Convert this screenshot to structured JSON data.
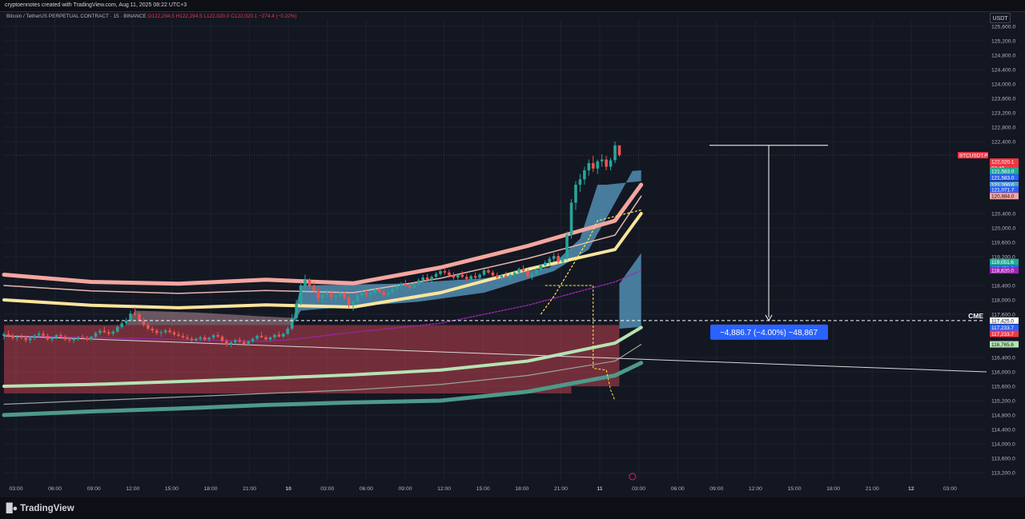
{
  "header": {
    "creator": "cryptoennotes created with TradingView.com, Aug 11, 2025 08:22 UTC+3"
  },
  "legend": {
    "symbol": "Bitcoin / TetherUS PERPETUAL CONTRACT · 15 · BINANCE",
    "open": "O122,294.5",
    "high": "H122,294.5",
    "low": "L122,020.0",
    "close": "C122,020.1",
    "change": "−274.4 (−0.22%)"
  },
  "currency": "USDT",
  "footer": {
    "brand": "TradingView"
  },
  "colors": {
    "background": "#131722",
    "up": "#26a69a",
    "down": "#ef5350",
    "ema_pink": "#f4a6a0",
    "ema_yellow": "#fbe59c",
    "ema_green": "#b6e3b2",
    "ema_teal": "#4e9a8a",
    "cloud_blue": "#5b9fc6",
    "cloud_red": "#c0424e",
    "vwap_purple": "#9c27b0"
  },
  "chart_data": {
    "type": "candlestick",
    "symbol": "BTCUSDT.P",
    "exchange": "BINANCE",
    "interval": "15",
    "ylim": [
      113000,
      125800
    ],
    "y_ticks": [
      113200,
      113600,
      114000,
      114400,
      114800,
      115200,
      115600,
      116000,
      116400,
      117600,
      118000,
      118400,
      119200,
      119600,
      120000,
      120400,
      122400,
      122800,
      123200,
      123600,
      124000,
      124400,
      124800,
      125200,
      125600
    ],
    "x_ticks": [
      "03:00",
      "06:00",
      "09:00",
      "12:00",
      "15:00",
      "18:00",
      "21:00",
      "10",
      "03:00",
      "06:00",
      "09:00",
      "12:00",
      "15:00",
      "18:00",
      "21:00",
      "11",
      "03:00",
      "06:00",
      "09:00",
      "12:00",
      "15:00",
      "18:00",
      "21:00",
      "12",
      "03:00"
    ],
    "price_labels": [
      {
        "text": "BTCUSDT.P",
        "value": 122020.1,
        "color": "#f23645"
      },
      {
        "text": "122,020.1",
        "value": 122020.1,
        "color": "#f23645"
      },
      {
        "text": "07:49",
        "value": 122020.1,
        "color": "#f23645"
      },
      {
        "text": "121,583.0",
        "value": 121583.0,
        "color": "#22ab94"
      },
      {
        "text": "121,583.0",
        "value": 121583.0,
        "color": "#2962ff"
      },
      {
        "text": "121,200.0",
        "value": 121200.0,
        "color": "#5b9fc6"
      },
      {
        "text": "121,071.7",
        "value": 121071.7,
        "color": "#2962ff"
      },
      {
        "text": "121,071.7",
        "value": 121071.7,
        "color": "#f23645"
      },
      {
        "text": "120,884.0",
        "value": 120884.0,
        "color": "#f4a6a0"
      },
      {
        "text": "119,051.6",
        "value": 119051.6,
        "color": "#22ab94"
      },
      {
        "text": "119,051.6",
        "value": 119051.6,
        "color": "#2962ff"
      },
      {
        "text": "118,820.0",
        "value": 118820.0,
        "color": "#9c27b0"
      },
      {
        "text": "117,425.0",
        "value": 117425.0,
        "color": "#ffffff"
      },
      {
        "text": "117,233.7",
        "value": 117233.7,
        "color": "#2962ff"
      },
      {
        "text": "117,233.7",
        "value": 117233.7,
        "color": "#f23645"
      },
      {
        "text": "116,765.6",
        "value": 116765.6,
        "color": "#b6e3b2"
      }
    ],
    "levels": [
      {
        "name": "CME",
        "value": 117425.0
      }
    ],
    "measure": {
      "from": 122294.5,
      "to": 117425.0,
      "label": "−4,886.7 (−4.00%) −48,867"
    },
    "candles": [
      [
        117000,
        117100,
        116900,
        117050
      ],
      [
        117050,
        117150,
        116950,
        117000
      ],
      [
        117000,
        117080,
        116880,
        116940
      ],
      [
        116940,
        117020,
        116850,
        116980
      ],
      [
        116980,
        117060,
        116900,
        116950
      ],
      [
        116950,
        117000,
        116820,
        116880
      ],
      [
        116880,
        116980,
        116800,
        116940
      ],
      [
        116940,
        117050,
        116880,
        117010
      ],
      [
        117010,
        117120,
        116960,
        117060
      ],
      [
        117060,
        117140,
        116980,
        117000
      ],
      [
        117000,
        117060,
        116860,
        116900
      ],
      [
        116900,
        116980,
        116820,
        116950
      ],
      [
        116950,
        117050,
        116900,
        117020
      ],
      [
        117020,
        117100,
        116950,
        116980
      ],
      [
        116980,
        117040,
        116860,
        116900
      ],
      [
        116900,
        116960,
        116820,
        116880
      ],
      [
        116880,
        116960,
        116800,
        116920
      ],
      [
        116920,
        117000,
        116860,
        116960
      ],
      [
        116960,
        117040,
        116900,
        116940
      ],
      [
        116940,
        117000,
        116850,
        116900
      ],
      [
        116900,
        117000,
        116860,
        116980
      ],
      [
        116980,
        117120,
        116940,
        117080
      ],
      [
        117080,
        117200,
        117020,
        117140
      ],
      [
        117140,
        117260,
        117080,
        117100
      ],
      [
        117100,
        117180,
        117000,
        117060
      ],
      [
        117060,
        117160,
        117000,
        117120
      ],
      [
        117120,
        117300,
        117080,
        117250
      ],
      [
        117250,
        117400,
        117200,
        117350
      ],
      [
        117350,
        117500,
        117300,
        117420
      ],
      [
        117420,
        117700,
        117380,
        117620
      ],
      [
        117620,
        117800,
        117550,
        117600
      ],
      [
        117600,
        117660,
        117380,
        117420
      ],
      [
        117420,
        117500,
        117250,
        117300
      ],
      [
        117300,
        117360,
        117150,
        117200
      ],
      [
        117200,
        117260,
        117080,
        117150
      ],
      [
        117150,
        117200,
        117020,
        117080
      ],
      [
        117080,
        117160,
        116980,
        117100
      ],
      [
        117100,
        117200,
        117040,
        117150
      ],
      [
        117150,
        117220,
        117060,
        117100
      ],
      [
        117100,
        117160,
        116980,
        117040
      ],
      [
        117040,
        117120,
        116960,
        117000
      ],
      [
        117000,
        117080,
        116920,
        116960
      ],
      [
        116960,
        117040,
        116880,
        116920
      ],
      [
        116920,
        116980,
        116820,
        116880
      ],
      [
        116880,
        116960,
        116800,
        116920
      ],
      [
        116920,
        117000,
        116860,
        116960
      ],
      [
        116960,
        117020,
        116860,
        116900
      ],
      [
        116900,
        116980,
        116840,
        116950
      ],
      [
        116950,
        117060,
        116900,
        117020
      ],
      [
        117020,
        117100,
        116940,
        116980
      ],
      [
        116980,
        117020,
        116820,
        116860
      ],
      [
        116860,
        116920,
        116700,
        116760
      ],
      [
        116760,
        116860,
        116680,
        116820
      ],
      [
        116820,
        116920,
        116760,
        116880
      ],
      [
        116880,
        116960,
        116800,
        116840
      ],
      [
        116840,
        116900,
        116720,
        116780
      ],
      [
        116780,
        116880,
        116720,
        116850
      ],
      [
        116850,
        116960,
        116800,
        116920
      ],
      [
        116920,
        117040,
        116880,
        117000
      ],
      [
        117000,
        117100,
        116940,
        116960
      ],
      [
        116960,
        117020,
        116860,
        116900
      ],
      [
        116900,
        116980,
        116840,
        116960
      ],
      [
        116960,
        117060,
        116900,
        117030
      ],
      [
        117030,
        117120,
        116960,
        116980
      ],
      [
        116980,
        117080,
        116940,
        117060
      ],
      [
        117060,
        117260,
        117020,
        117200
      ],
      [
        117200,
        117600,
        117150,
        117500
      ],
      [
        117500,
        118000,
        117450,
        117900
      ],
      [
        117900,
        118500,
        117850,
        118400
      ],
      [
        118400,
        118700,
        118300,
        118550
      ],
      [
        118550,
        118600,
        118300,
        118380
      ],
      [
        118380,
        118500,
        118200,
        118250
      ],
      [
        118250,
        118350,
        117950,
        118050
      ],
      [
        118050,
        118200,
        117900,
        118150
      ],
      [
        118150,
        118300,
        118050,
        118200
      ],
      [
        118200,
        118280,
        118000,
        118080
      ],
      [
        118080,
        118200,
        117980,
        118120
      ],
      [
        118120,
        118260,
        118040,
        118180
      ],
      [
        118180,
        118240,
        118000,
        118060
      ],
      [
        118060,
        118120,
        117780,
        117850
      ],
      [
        117850,
        118000,
        117700,
        117950
      ],
      [
        117950,
        118180,
        117900,
        118120
      ],
      [
        118120,
        118260,
        118040,
        118200
      ],
      [
        118200,
        118300,
        118080,
        118150
      ],
      [
        118150,
        118250,
        118050,
        118200
      ],
      [
        118200,
        118340,
        118140,
        118280
      ],
      [
        118280,
        118380,
        118180,
        118220
      ],
      [
        118220,
        118300,
        118080,
        118140
      ],
      [
        118140,
        118260,
        118080,
        118200
      ],
      [
        118200,
        118360,
        118160,
        118300
      ],
      [
        118300,
        118440,
        118240,
        118380
      ],
      [
        118380,
        118500,
        118300,
        118440
      ],
      [
        118440,
        118560,
        118360,
        118400
      ],
      [
        118400,
        118480,
        118280,
        118340
      ],
      [
        118340,
        118480,
        118300,
        118440
      ],
      [
        118440,
        118600,
        118400,
        118540
      ],
      [
        118540,
        118700,
        118480,
        118620
      ],
      [
        118620,
        118720,
        118500,
        118560
      ],
      [
        118560,
        118680,
        118480,
        118640
      ],
      [
        118640,
        118780,
        118580,
        118720
      ],
      [
        118720,
        118860,
        118660,
        118800
      ],
      [
        118800,
        118900,
        118700,
        118760
      ],
      [
        118760,
        118840,
        118620,
        118680
      ],
      [
        118680,
        118760,
        118560,
        118620
      ],
      [
        118620,
        118740,
        118560,
        118700
      ],
      [
        118700,
        118800,
        118600,
        118640
      ],
      [
        118640,
        118720,
        118520,
        118580
      ],
      [
        118580,
        118700,
        118520,
        118660
      ],
      [
        118660,
        118760,
        118580,
        118620
      ],
      [
        118620,
        118740,
        118560,
        118700
      ],
      [
        118700,
        118860,
        118660,
        118820
      ],
      [
        118820,
        118920,
        118720,
        118760
      ],
      [
        118760,
        118820,
        118620,
        118680
      ],
      [
        118680,
        118760,
        118560,
        118620
      ],
      [
        118620,
        118720,
        118540,
        118680
      ],
      [
        118680,
        118780,
        118600,
        118640
      ],
      [
        118640,
        118740,
        118560,
        118700
      ],
      [
        118700,
        118820,
        118640,
        118760
      ],
      [
        118760,
        118900,
        118700,
        118860
      ],
      [
        118860,
        118960,
        118760,
        118800
      ],
      [
        118800,
        118860,
        118600,
        118650
      ],
      [
        118650,
        118760,
        118560,
        118720
      ],
      [
        118720,
        118880,
        118680,
        118840
      ],
      [
        118840,
        119000,
        118800,
        118960
      ],
      [
        118960,
        119100,
        118880,
        119040
      ],
      [
        119040,
        119200,
        118960,
        119140
      ],
      [
        119140,
        119300,
        119060,
        119220
      ],
      [
        119220,
        119300,
        119000,
        119060
      ],
      [
        119060,
        119200,
        118980,
        119160
      ],
      [
        119160,
        119900,
        119100,
        119800
      ],
      [
        119800,
        120800,
        119700,
        120700
      ],
      [
        120700,
        121300,
        120500,
        121200
      ],
      [
        121200,
        121500,
        121000,
        121350
      ],
      [
        121350,
        121700,
        121200,
        121600
      ],
      [
        121600,
        121900,
        121450,
        121800
      ],
      [
        121800,
        122000,
        121550,
        121650
      ],
      [
        121650,
        121900,
        121500,
        121850
      ],
      [
        121850,
        122050,
        121700,
        121900
      ],
      [
        121900,
        122000,
        121600,
        121700
      ],
      [
        121700,
        121950,
        121600,
        121880
      ],
      [
        121880,
        122400,
        121800,
        122294
      ],
      [
        122294,
        122294,
        121980,
        122020
      ]
    ],
    "indicators": [
      {
        "name": "EMA-pink",
        "color": "#f4a6a0",
        "points": [
          [
            0,
            118700
          ],
          [
            20,
            118500
          ],
          [
            40,
            118450
          ],
          [
            60,
            118560
          ],
          [
            80,
            118460
          ],
          [
            100,
            118900
          ],
          [
            120,
            119500
          ],
          [
            140,
            120200
          ],
          [
            146,
            121200
          ]
        ]
      },
      {
        "name": "EMA-pink-thin",
        "color": "#e6b7b0",
        "points": [
          [
            0,
            118400
          ],
          [
            20,
            118250
          ],
          [
            40,
            118180
          ],
          [
            60,
            118260
          ],
          [
            80,
            118200
          ],
          [
            100,
            118600
          ],
          [
            120,
            119150
          ],
          [
            140,
            119800
          ],
          [
            146,
            120884
          ]
        ]
      },
      {
        "name": "EMA-yellow",
        "color": "#fbe59c",
        "points": [
          [
            0,
            118000
          ],
          [
            20,
            117850
          ],
          [
            40,
            117780
          ],
          [
            60,
            117860
          ],
          [
            80,
            117800
          ],
          [
            100,
            118200
          ],
          [
            120,
            118850
          ],
          [
            140,
            119400
          ],
          [
            146,
            120400
          ]
        ]
      },
      {
        "name": "EMA-green",
        "color": "#b6e3b2",
        "points": [
          [
            0,
            115600
          ],
          [
            20,
            115650
          ],
          [
            40,
            115730
          ],
          [
            60,
            115820
          ],
          [
            80,
            115920
          ],
          [
            100,
            116050
          ],
          [
            120,
            116300
          ],
          [
            140,
            116800
          ],
          [
            146,
            117233
          ]
        ]
      },
      {
        "name": "EMA-gray",
        "color": "#9aa39b",
        "points": [
          [
            0,
            115100
          ],
          [
            20,
            115200
          ],
          [
            40,
            115300
          ],
          [
            60,
            115400
          ],
          [
            80,
            115500
          ],
          [
            100,
            115650
          ],
          [
            120,
            115900
          ],
          [
            140,
            116300
          ],
          [
            146,
            116765
          ]
        ]
      },
      {
        "name": "EMA-teal",
        "color": "#4e9a8a",
        "points": [
          [
            0,
            114800
          ],
          [
            20,
            114900
          ],
          [
            40,
            114980
          ],
          [
            60,
            115080
          ],
          [
            80,
            115150
          ],
          [
            100,
            115200
          ],
          [
            120,
            115450
          ],
          [
            140,
            115900
          ],
          [
            146,
            116250
          ]
        ]
      },
      {
        "name": "VWAP",
        "color": "#9c27b0",
        "points": [
          [
            0,
            117000
          ],
          [
            20,
            116960
          ],
          [
            40,
            116900
          ],
          [
            60,
            116850
          ],
          [
            66,
            116900
          ],
          [
            80,
            117100
          ],
          [
            100,
            117350
          ],
          [
            120,
            117850
          ],
          [
            140,
            118500
          ],
          [
            146,
            118820
          ]
        ]
      }
    ]
  }
}
